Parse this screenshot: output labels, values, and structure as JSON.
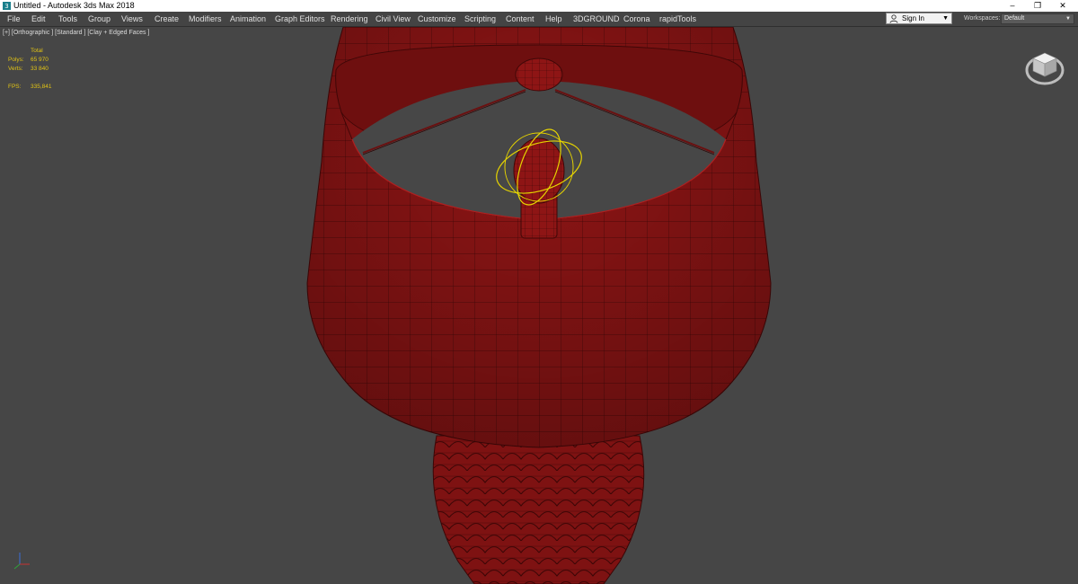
{
  "window": {
    "title": "Untitled - Autodesk 3ds Max 2018",
    "minimize_glyph": "–",
    "restore_glyph": "❐",
    "close_glyph": "✕"
  },
  "menu": {
    "items": [
      "File",
      "Edit",
      "Tools",
      "Group",
      "Views",
      "Create",
      "Modifiers",
      "Animation",
      "Graph Editors",
      "Rendering",
      "Civil View",
      "Customize",
      "Scripting",
      "Content",
      "Help",
      "3DGROUND",
      "Corona",
      "rapidTools"
    ]
  },
  "account": {
    "sign_in_label": "Sign In",
    "workspaces_label": "Workspaces:",
    "workspace_value": "Default"
  },
  "viewport": {
    "label": "[+] [Orthographic ] [Standard ] [Clay + Edged Faces ]",
    "stats": {
      "header": "Total",
      "polys_label": "Polys:",
      "polys_value": "65 970",
      "verts_label": "Verts:",
      "verts_value": "33 840",
      "fps_label": "FPS:",
      "fps_value": "335,841"
    }
  },
  "colors": {
    "viewport_bg": "#464646",
    "clay_model": "#8e1515",
    "stat_text": "#e3c414",
    "gizmo": "#e6d400"
  },
  "icons": [
    "app-icon",
    "user-icon",
    "chevron-down-icon",
    "viewcube-icon",
    "axis-tripod-icon"
  ]
}
